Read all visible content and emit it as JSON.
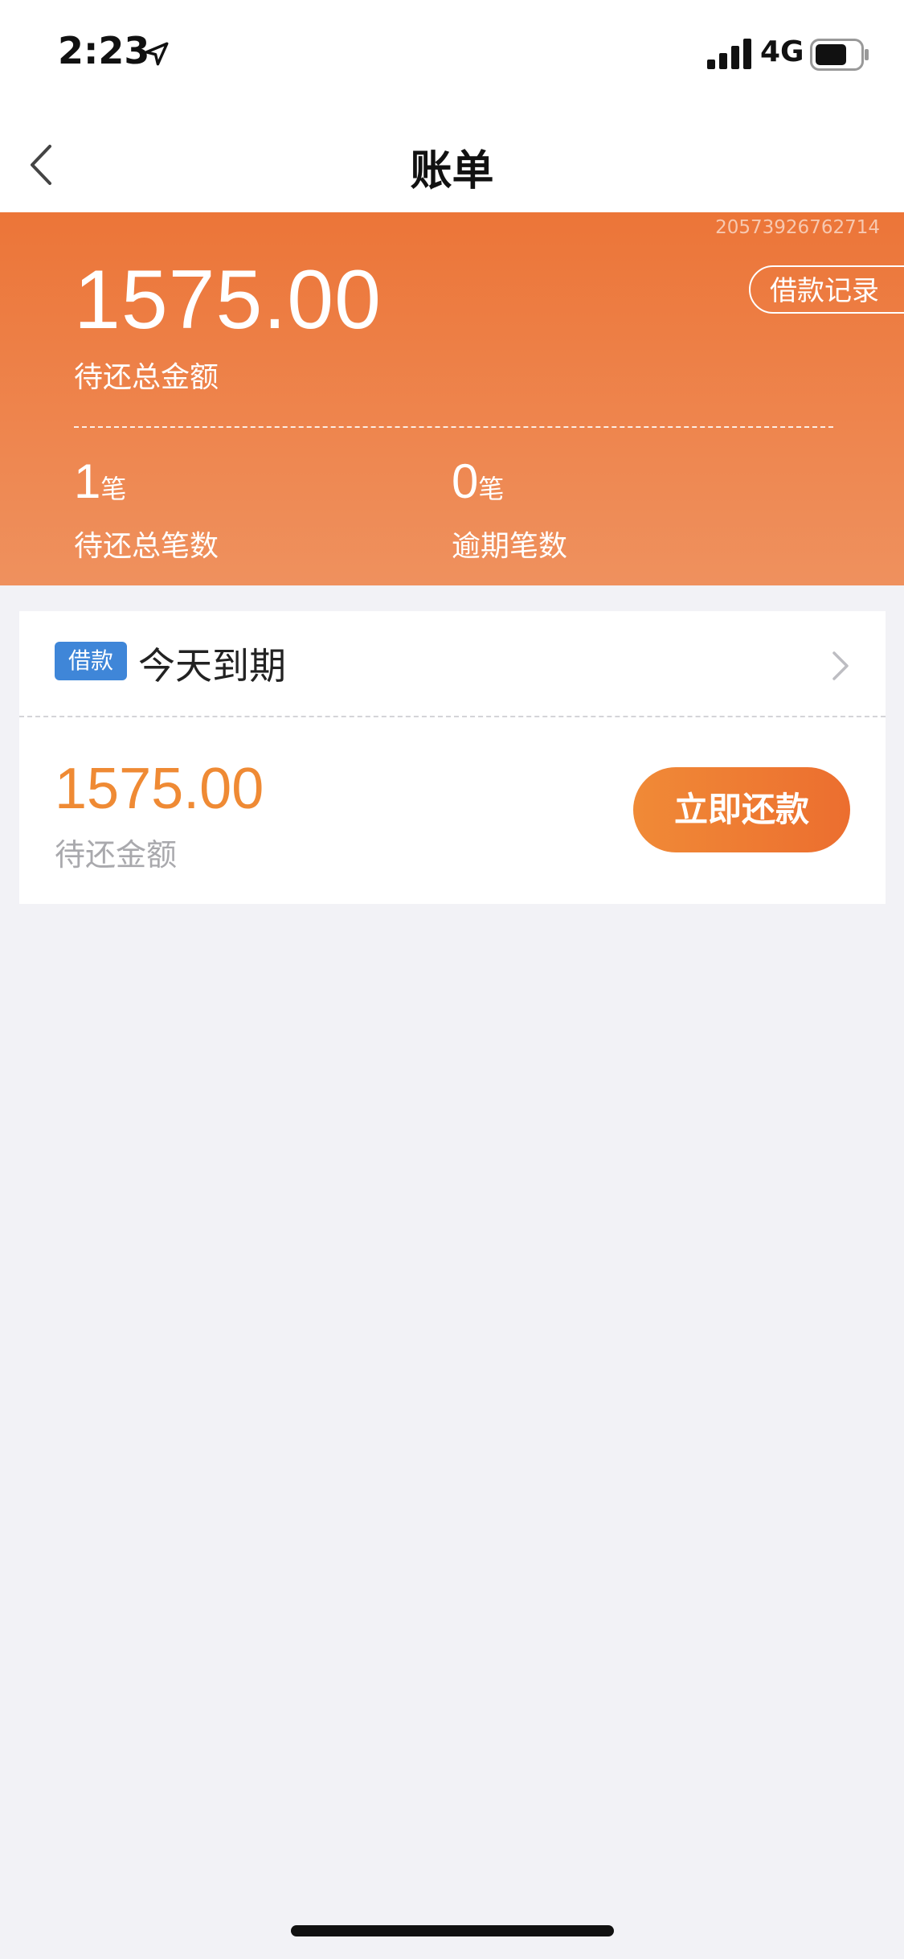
{
  "status_bar": {
    "time": "2:23",
    "network": "4G",
    "icons": [
      "location-arrow-icon",
      "signal-bars-icon",
      "battery-icon"
    ]
  },
  "nav": {
    "title": "账单",
    "back_icon": "chevron-left-icon"
  },
  "summary": {
    "order_number": "20573926762714",
    "history_button": "借款记录",
    "total_amount": "1575.00",
    "total_label": "待还总金额",
    "stats": [
      {
        "value": "1",
        "unit": "笔",
        "label": "待还总笔数"
      },
      {
        "value": "0",
        "unit": "笔",
        "label": "逾期笔数"
      }
    ]
  },
  "bill": {
    "tag": "借款",
    "due_text": "今天到期",
    "amount": "1575.00",
    "amount_label": "待还金额",
    "repay_button": "立即还款"
  },
  "colors": {
    "accent_orange": "#ec7538",
    "amount_orange": "#ef8a34",
    "tag_blue": "#3f86d8",
    "background": "#f2f2f6"
  }
}
